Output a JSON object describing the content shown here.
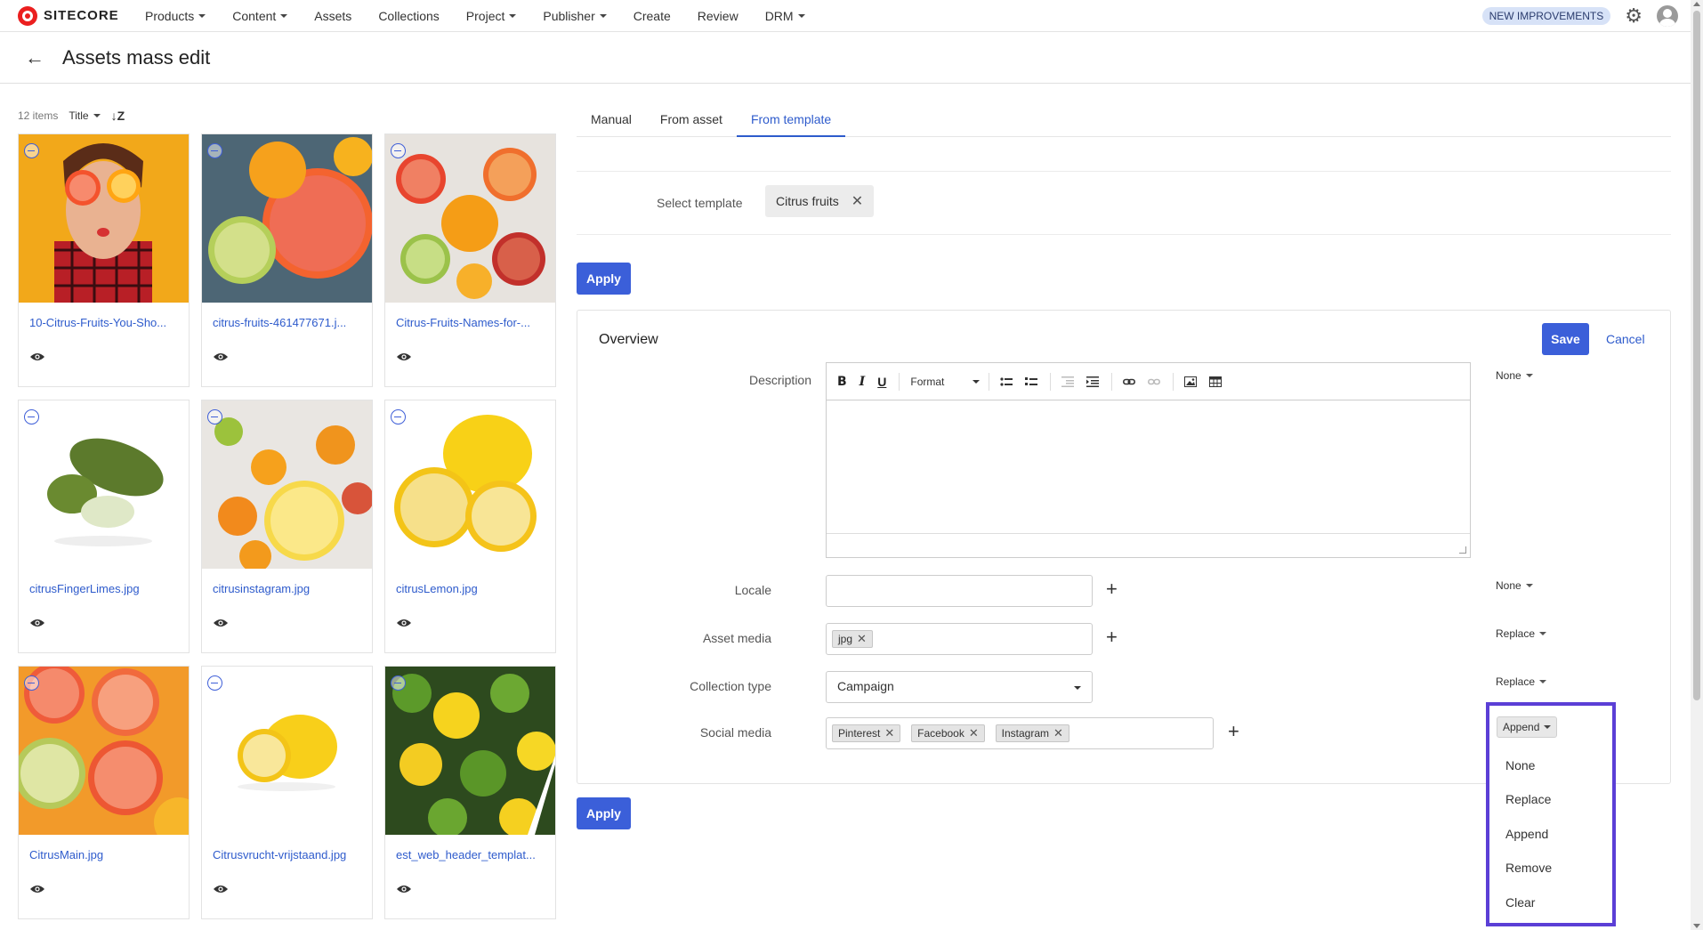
{
  "app": {
    "logo_text": "SITECORE"
  },
  "nav": {
    "items": [
      {
        "label": "Products",
        "dropdown": true
      },
      {
        "label": "Content",
        "dropdown": true
      },
      {
        "label": "Assets",
        "dropdown": false
      },
      {
        "label": "Collections",
        "dropdown": false
      },
      {
        "label": "Project",
        "dropdown": true
      },
      {
        "label": "Publisher",
        "dropdown": true
      },
      {
        "label": "Create",
        "dropdown": false
      },
      {
        "label": "Review",
        "dropdown": false
      },
      {
        "label": "DRM",
        "dropdown": true
      }
    ],
    "new_improvements": "NEW IMPROVEMENTS"
  },
  "page": {
    "title": "Assets mass edit"
  },
  "list": {
    "count": "12 items",
    "sort_by": "Title",
    "sort_icon": "sort-az-icon",
    "assets": [
      {
        "filename": "10-Citrus-Fruits-You-Sho...",
        "image": "woman-citrus-eyes"
      },
      {
        "filename": "citrus-fruits-461477671.j...",
        "image": "grapefruit-lime"
      },
      {
        "filename": "Citrus-Fruits-Names-for-...",
        "image": "mixed-citrus"
      },
      {
        "filename": "citrusFingerLimes.jpg",
        "image": "finger-limes"
      },
      {
        "filename": "citrusinstagram.jpg",
        "image": "citrus-flatlay"
      },
      {
        "filename": "citrusLemon.jpg",
        "image": "lemons"
      },
      {
        "filename": "CitrusMain.jpg",
        "image": "citrus-slices"
      },
      {
        "filename": "Citrusvrucht-vrijstaand.jpg",
        "image": "lemon-isolated"
      },
      {
        "filename": "est_web_header_templat...",
        "image": "limes-lemons"
      }
    ]
  },
  "tabs": [
    {
      "label": "Manual",
      "active": false
    },
    {
      "label": "From asset",
      "active": false
    },
    {
      "label": "From template",
      "active": true
    }
  ],
  "template": {
    "label": "Select template",
    "selected": "Citrus fruits"
  },
  "buttons": {
    "apply": "Apply",
    "save": "Save",
    "cancel": "Cancel"
  },
  "overview": {
    "title": "Overview",
    "fields": {
      "description": {
        "label": "Description",
        "mode": "None"
      },
      "locale": {
        "label": "Locale",
        "mode": "None",
        "value": ""
      },
      "asset_media": {
        "label": "Asset media",
        "mode": "Replace",
        "chips": [
          "jpg"
        ]
      },
      "collection_type": {
        "label": "Collection type",
        "mode": "Replace",
        "value": "Campaign"
      },
      "social_media": {
        "label": "Social media",
        "mode": "Append",
        "chips": [
          "Pinterest",
          "Facebook",
          "Instagram"
        ]
      }
    },
    "editor_format": "Format"
  },
  "mode_dropdown": {
    "current": "Append",
    "options": [
      "None",
      "Replace",
      "Append",
      "Remove",
      "Clear"
    ]
  },
  "colors": {
    "accent": "#3b5fd9",
    "link": "#2e5bcc",
    "highlight_border": "#5b3fd6",
    "logo_red": "#eb1f1f"
  }
}
